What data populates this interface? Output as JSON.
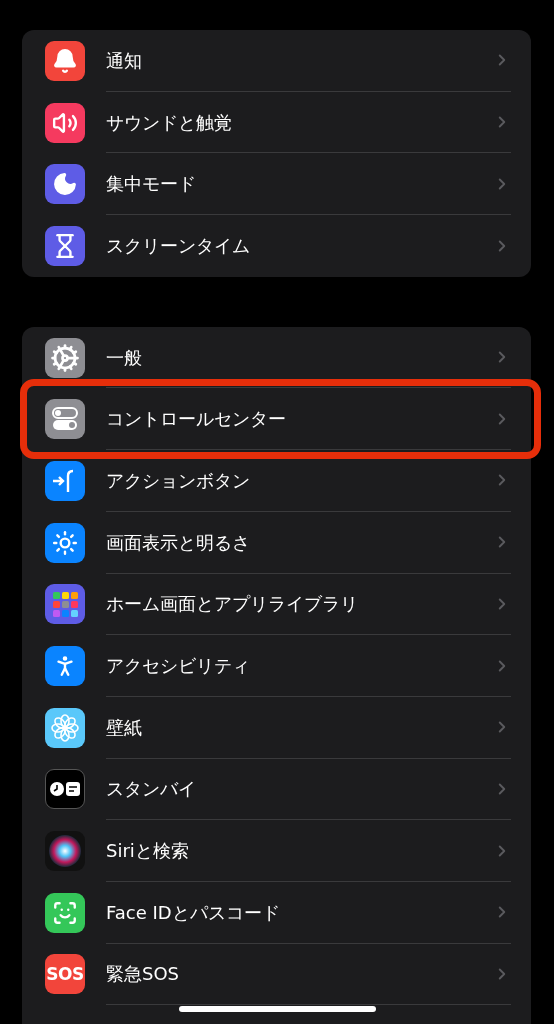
{
  "groups": [
    {
      "items": [
        {
          "label": "通知",
          "kind": "bell",
          "highlighted": false
        },
        {
          "label": "サウンドと触覚",
          "kind": "sound",
          "highlighted": false
        },
        {
          "label": "集中モード",
          "kind": "moon",
          "highlighted": false
        },
        {
          "label": "スクリーンタイム",
          "kind": "hourglass",
          "highlighted": false
        }
      ]
    },
    {
      "items": [
        {
          "label": "一般",
          "kind": "gear",
          "highlighted": false
        },
        {
          "label": "コントロールセンター",
          "kind": "toggles",
          "highlighted": true
        },
        {
          "label": "アクションボタン",
          "kind": "action",
          "highlighted": false
        },
        {
          "label": "画面表示と明るさ",
          "kind": "sun",
          "highlighted": false
        },
        {
          "label": "ホーム画面とアプリライブラリ",
          "kind": "grid",
          "highlighted": false
        },
        {
          "label": "アクセシビリティ",
          "kind": "accessibility",
          "highlighted": false
        },
        {
          "label": "壁紙",
          "kind": "flower",
          "highlighted": false
        },
        {
          "label": "スタンバイ",
          "kind": "standby",
          "highlighted": false
        },
        {
          "label": "Siriと検索",
          "kind": "siri",
          "highlighted": false
        },
        {
          "label": "Face IDとパスコード",
          "kind": "faceid",
          "highlighted": false
        },
        {
          "label": "緊急SOS",
          "kind": "sos",
          "icon_text": "SOS",
          "highlighted": false
        }
      ]
    }
  ]
}
